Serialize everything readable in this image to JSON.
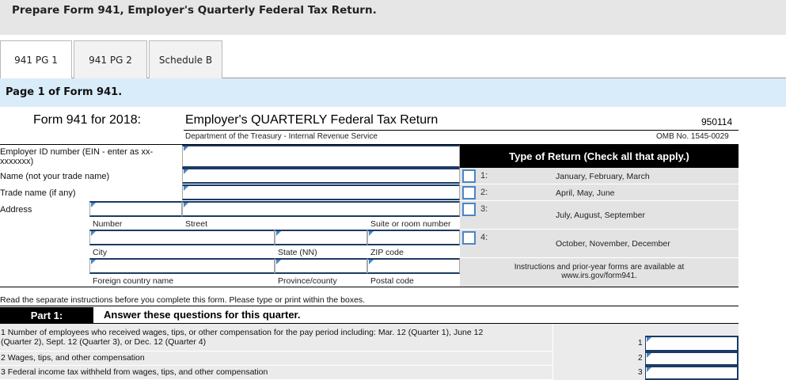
{
  "banner": {
    "title": "Prepare Form 941, Employer's Quarterly Federal Tax Return."
  },
  "tabs": [
    {
      "label": "941 PG 1",
      "active": true
    },
    {
      "label": "941 PG 2",
      "active": false
    },
    {
      "label": "Schedule B",
      "active": false
    }
  ],
  "page_header": "Page 1 of Form 941.",
  "form": {
    "number_label": "Form 941 for 2018:",
    "title": "Employer's QUARTERLY Federal Tax Return",
    "department": "Department of the Treasury - Internal Revenue Service",
    "code": "950114",
    "omb": "OMB No. 1545-0029"
  },
  "employer": {
    "ein_label": "Employer ID number (EIN - enter as xx-xxxxxxx)",
    "ein_value": "",
    "name_label": "Name (not your trade name)",
    "name_value": "",
    "trade_label": "Trade name (if any)",
    "trade_value": "",
    "address_label": "Address",
    "number_label": "Number",
    "street_label": "Street",
    "suite_label": "Suite or room number",
    "city_label": "City",
    "state_label": "State (NN)",
    "zip_label": "ZIP code",
    "foreign_country_label": "Foreign country name",
    "province_label": "Province/county",
    "postal_label": "Postal code"
  },
  "type_of_return": {
    "heading": "Type of Return (Check all that apply.)",
    "options": [
      {
        "num": "1:",
        "label": "January, February, March",
        "checked": false
      },
      {
        "num": "2:",
        "label": "April, May, June",
        "checked": false
      },
      {
        "num": "3:",
        "label": "July, August, September",
        "checked": false
      },
      {
        "num": "4:",
        "label": "October, November, December",
        "checked": false
      }
    ],
    "instructions_line1": "Instructions and prior-year forms are available at",
    "instructions_line2": "www.irs.gov/form941."
  },
  "instructions": "Read the separate instructions before you complete this form.  Please type or print within the boxes.",
  "part1": {
    "label": "Part 1:",
    "title": "Answer these questions for this quarter.",
    "questions": [
      {
        "num": "1",
        "text_line1": "1  Number of employees who received wages, tips, or other compensation for the pay period including:  Mar. 12 (Quarter 1), June 12",
        "text_line2": "(Quarter 2), Sept. 12 (Quarter 3), or Dec. 12 (Quarter 4)",
        "value": ""
      },
      {
        "num": "2",
        "text_line1": "2  Wages, tips, and other compensation",
        "text_line2": "",
        "value": ""
      },
      {
        "num": "3",
        "text_line1": "3  Federal income tax withheld from wages, tips, and other compensation",
        "text_line2": "",
        "value": ""
      }
    ]
  },
  "colors": {
    "banner_bg": "#e6e6e6",
    "page_header_bg": "#d9ecf9",
    "field_border": "#1b3a66",
    "checkbox_border": "#4a86c5",
    "row_bg": "#e3e3e3"
  }
}
